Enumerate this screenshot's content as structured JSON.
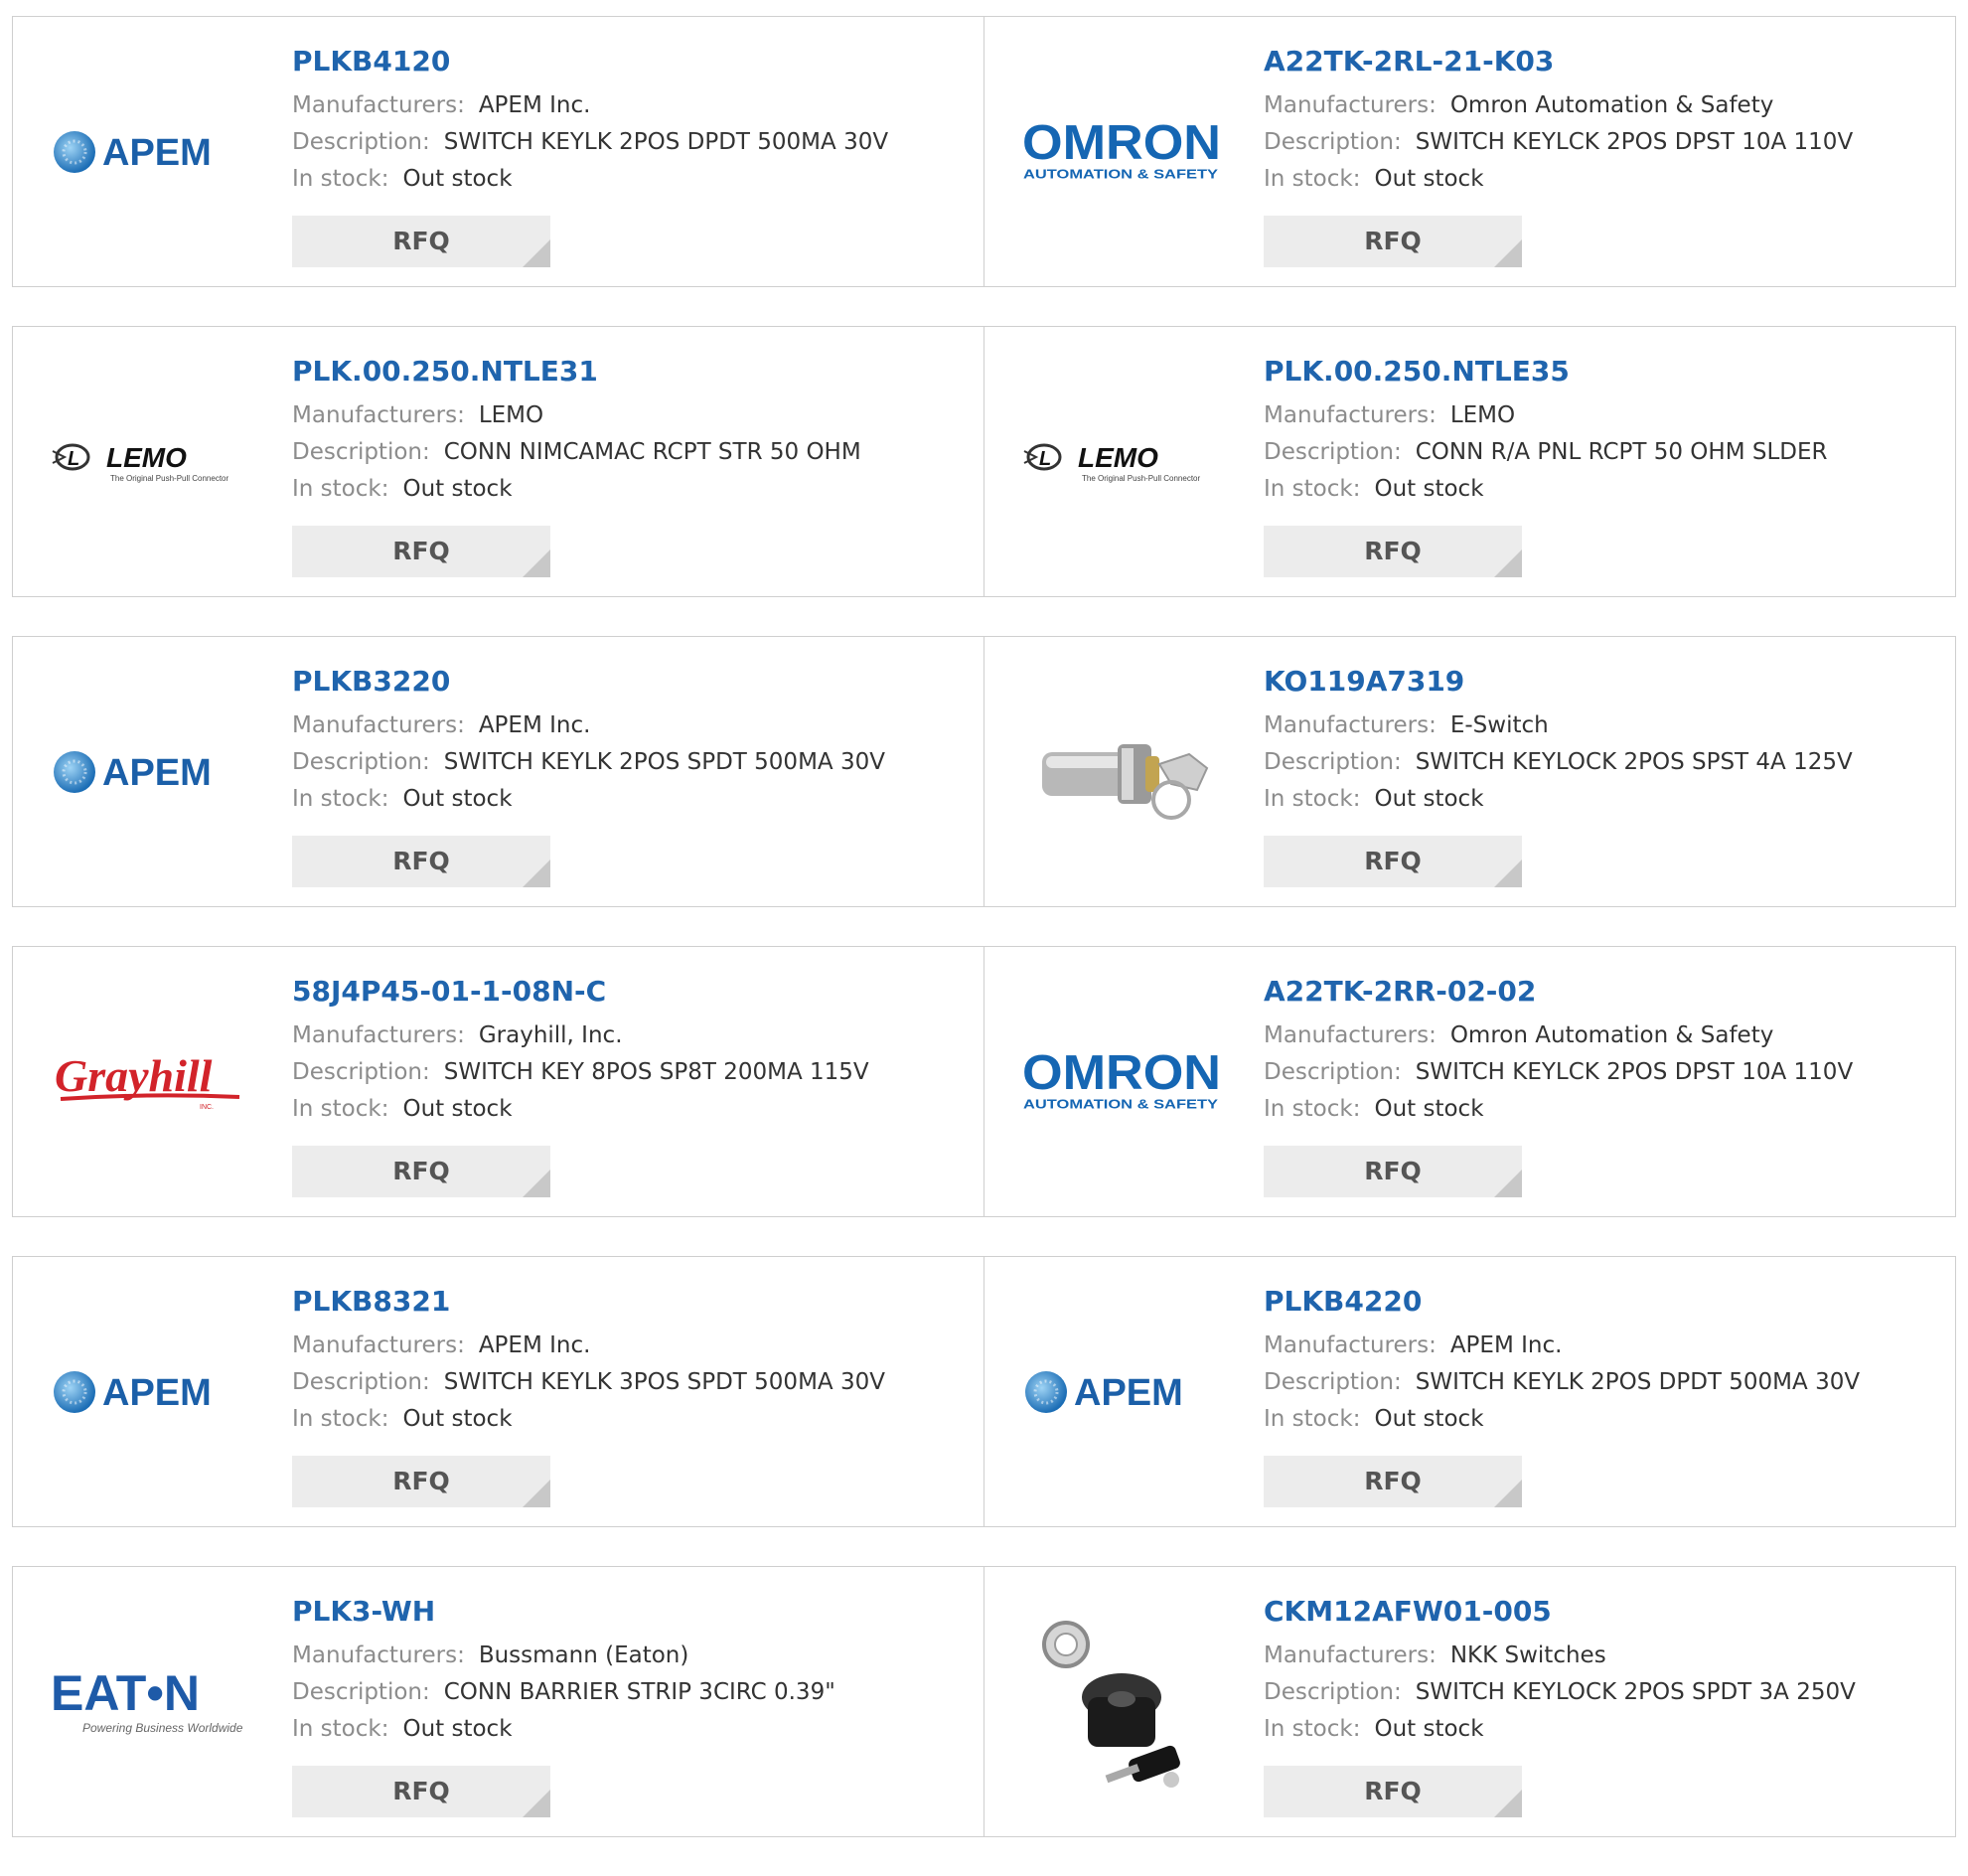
{
  "labels": {
    "manufacturers": "Manufacturers:",
    "description": "Description:",
    "in_stock": "In stock:",
    "rfq": "RFQ"
  },
  "products": [
    {
      "part": "PLKB4120",
      "manufacturer": "APEM Inc.",
      "description": "SWITCH KEYLK 2POS DPDT 500MA 30V",
      "stock": "Out stock",
      "logo": "apem-logo"
    },
    {
      "part": "A22TK-2RL-21-K03",
      "manufacturer": "Omron Automation & Safety",
      "description": "SWITCH KEYLCK 2POS DPST 10A 110V",
      "stock": "Out stock",
      "logo": "omron-logo"
    },
    {
      "part": "PLK.00.250.NTLE31",
      "manufacturer": "LEMO",
      "description": "CONN NIMCAMAC RCPT STR 50 OHM",
      "stock": "Out stock",
      "logo": "lemo-logo"
    },
    {
      "part": "PLK.00.250.NTLE35",
      "manufacturer": "LEMO",
      "description": "CONN R/A PNL RCPT 50 OHM SLDER",
      "stock": "Out stock",
      "logo": "lemo-logo"
    },
    {
      "part": "PLKB3220",
      "manufacturer": "APEM Inc.",
      "description": "SWITCH KEYLK 2POS SPDT 500MA 30V",
      "stock": "Out stock",
      "logo": "apem-logo"
    },
    {
      "part": "KO119A7319",
      "manufacturer": "E-Switch",
      "description": "SWITCH KEYLOCK 2POS SPST 4A 125V",
      "stock": "Out stock",
      "logo": "keylock-switch-photo"
    },
    {
      "part": "58J4P45-01-1-08N-C",
      "manufacturer": "Grayhill, Inc.",
      "description": "SWITCH KEY 8POS SP8T 200MA 115V",
      "stock": "Out stock",
      "logo": "grayhill-logo"
    },
    {
      "part": "A22TK-2RR-02-02",
      "manufacturer": "Omron Automation & Safety",
      "description": "SWITCH KEYLCK 2POS DPST 10A 110V",
      "stock": "Out stock",
      "logo": "omron-logo"
    },
    {
      "part": "PLKB8321",
      "manufacturer": "APEM Inc.",
      "description": "SWITCH KEYLK 3POS SPDT 500MA 30V",
      "stock": "Out stock",
      "logo": "apem-logo"
    },
    {
      "part": "PLKB4220",
      "manufacturer": "APEM Inc.",
      "description": "SWITCH KEYLK 2POS DPDT 500MA 30V",
      "stock": "Out stock",
      "logo": "apem-logo"
    },
    {
      "part": "PLK3-WH",
      "manufacturer": "Bussmann (Eaton)",
      "description": "CONN BARRIER STRIP 3CIRC 0.39\"",
      "stock": "Out stock",
      "logo": "eaton-logo"
    },
    {
      "part": "CKM12AFW01-005",
      "manufacturer": "NKK Switches",
      "description": "SWITCH KEYLOCK 2POS SPDT 3A 250V",
      "stock": "Out stock",
      "logo": "keylock-switch-photo-2"
    }
  ],
  "brand_text": {
    "apem": "APEM",
    "omron": "OMRON",
    "omron_sub": "AUTOMATION & SAFETY",
    "lemo": "LEMO",
    "lemo_sub": "The Original Push-Pull Connector",
    "grayhill": "Grayhill",
    "grayhill_sub": "INC.",
    "eaton": "EAT•N",
    "eaton_sub": "Powering Business Worldwide"
  },
  "colors": {
    "link": "#1f64ad",
    "apem_blue": "#1b5fa8",
    "omron_blue": "#1566b3",
    "grayhill_red": "#d2232a",
    "eaton_blue": "#1e5aa8"
  }
}
